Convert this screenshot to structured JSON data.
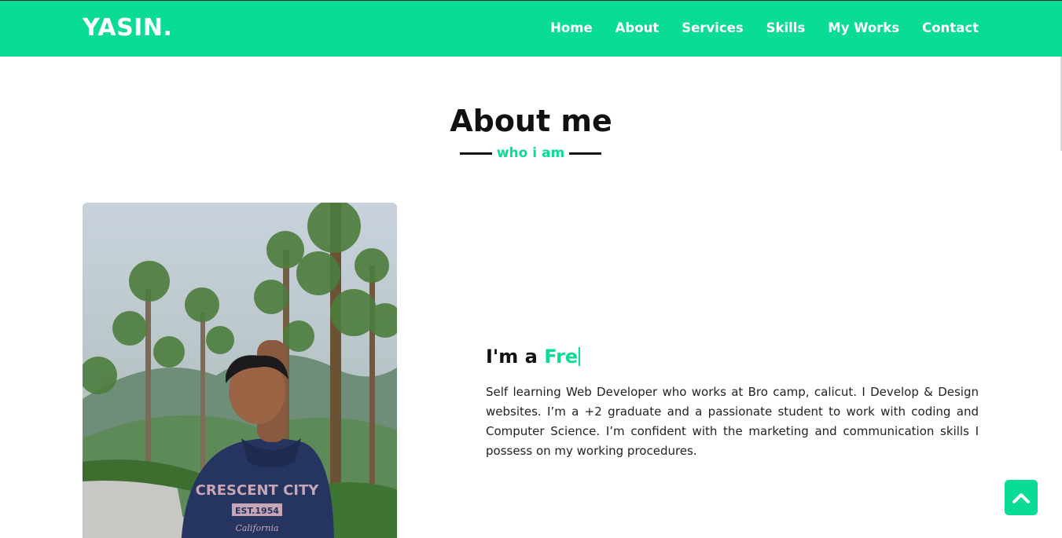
{
  "header": {
    "logo": "YASIN.",
    "nav": [
      "Home",
      "About",
      "Services",
      "Skills",
      "My Works",
      "Contact"
    ]
  },
  "about": {
    "title": "About me",
    "subtitle": "who i am",
    "intro_prefix": "I'm a ",
    "intro_typed": "Fre",
    "bio": "Self learning Web Developer who works at Bro camp, calicut. I Develop & Design websites. I’m a +2 graduate and a passionate student to work with coding and Computer Science. I’m confident with the marketing and communication skills I possess on my working procedures.",
    "photo_text": {
      "hoodie_line1": "CRESCENT CITY",
      "hoodie_line2": "EST.1954",
      "hoodie_line3": "California"
    }
  },
  "scroll_top": {
    "icon": "chevron-up-icon"
  },
  "colors": {
    "accent": "#0adc93",
    "text": "#111111",
    "background": "#ffffff"
  }
}
